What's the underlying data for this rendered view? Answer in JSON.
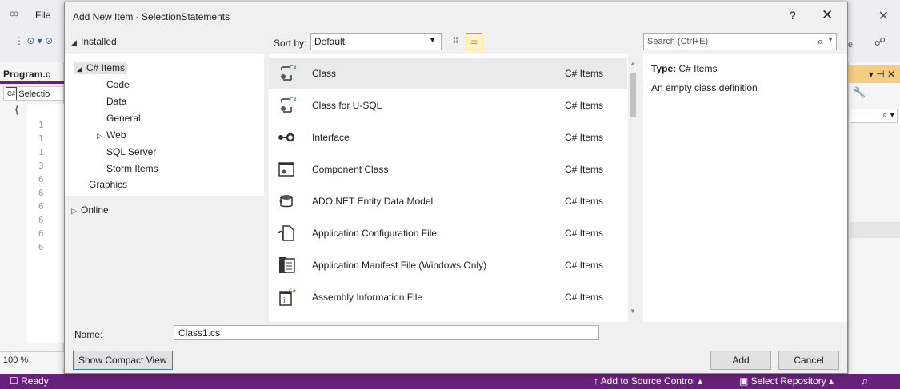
{
  "vs": {
    "menu_file": "File",
    "doc_tab": "Program.c",
    "nav_combo": "Selectio",
    "line_numbers": [
      "1",
      "1",
      "1",
      "3",
      "6",
      "6",
      "6",
      "6",
      "6",
      "6"
    ],
    "zoom": "100 %",
    "status": {
      "ready": "Ready",
      "source_control": "Add to Source Control",
      "repository": "Select Repository"
    }
  },
  "dialog": {
    "title": "Add New Item - SelectionStatements",
    "help": "?",
    "tree": {
      "installed": "Installed",
      "csharp_items": "C# Items",
      "children": [
        "Code",
        "Data",
        "General",
        "Web",
        "SQL Server",
        "Storm Items"
      ],
      "graphics": "Graphics",
      "online": "Online"
    },
    "sort": {
      "label": "Sort by:",
      "value": "Default"
    },
    "search": {
      "placeholder": "Search (Ctrl+E)"
    },
    "templates": [
      {
        "name": "Class",
        "category": "C# Items",
        "icon": "class-icon"
      },
      {
        "name": "Class for U-SQL",
        "category": "C# Items",
        "icon": "usql-class-icon"
      },
      {
        "name": "Interface",
        "category": "C# Items",
        "icon": "interface-icon"
      },
      {
        "name": "Component Class",
        "category": "C# Items",
        "icon": "component-class-icon"
      },
      {
        "name": "ADO.NET Entity Data Model",
        "category": "C# Items",
        "icon": "entity-model-icon"
      },
      {
        "name": "Application Configuration File",
        "category": "C# Items",
        "icon": "config-file-icon"
      },
      {
        "name": "Application Manifest File (Windows Only)",
        "category": "C# Items",
        "icon": "manifest-file-icon"
      },
      {
        "name": "Assembly Information File",
        "category": "C# Items",
        "icon": "assembly-info-icon"
      }
    ],
    "details": {
      "type_label": "Type:",
      "type_value": "C# Items",
      "description": "An empty class definition"
    },
    "name_label": "Name:",
    "name_value": "Class1.cs",
    "buttons": {
      "compact": "Show Compact View",
      "add": "Add",
      "cancel": "Cancel"
    }
  }
}
